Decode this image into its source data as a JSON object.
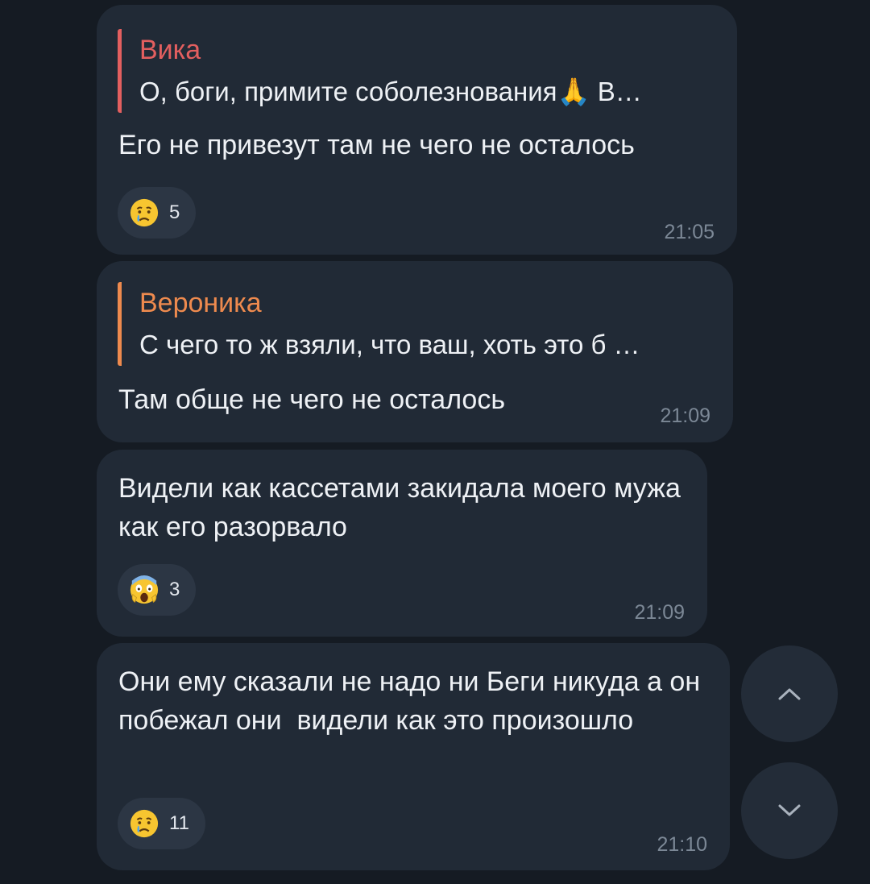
{
  "messages": [
    {
      "reply": {
        "name": "Вика",
        "text": "О, боги, примите соболезнования🙏 В…"
      },
      "text": "Его не привезут там не чего не осталось",
      "reaction": {
        "emoji": "crying-face",
        "count": "5"
      },
      "time": "21:05"
    },
    {
      "reply": {
        "name": "Вероника",
        "text": "С чего то ж взяли, что ваш, хоть это б …"
      },
      "text": "Там обще не чего не осталось",
      "time": "21:09"
    },
    {
      "text": "Видели как кассетами закидала моего мужа как его разорвало",
      "reaction": {
        "emoji": "screaming-face",
        "count": "3"
      },
      "time": "21:09"
    },
    {
      "text": "Они ему сказали не надо ни Беги никуда а он побежал они  видели как это произошло",
      "reaction": {
        "emoji": "crying-face",
        "count": "11"
      },
      "time": "21:10"
    }
  ],
  "colors": {
    "background": "#151b23",
    "bubble": "#212a36",
    "reply_vika": "#e35f5f",
    "reply_veronika": "#ee8a4e",
    "timestamp": "#7c8896"
  },
  "icons": {
    "scroll_up": "chevron-up-icon",
    "scroll_down": "chevron-down-icon"
  }
}
